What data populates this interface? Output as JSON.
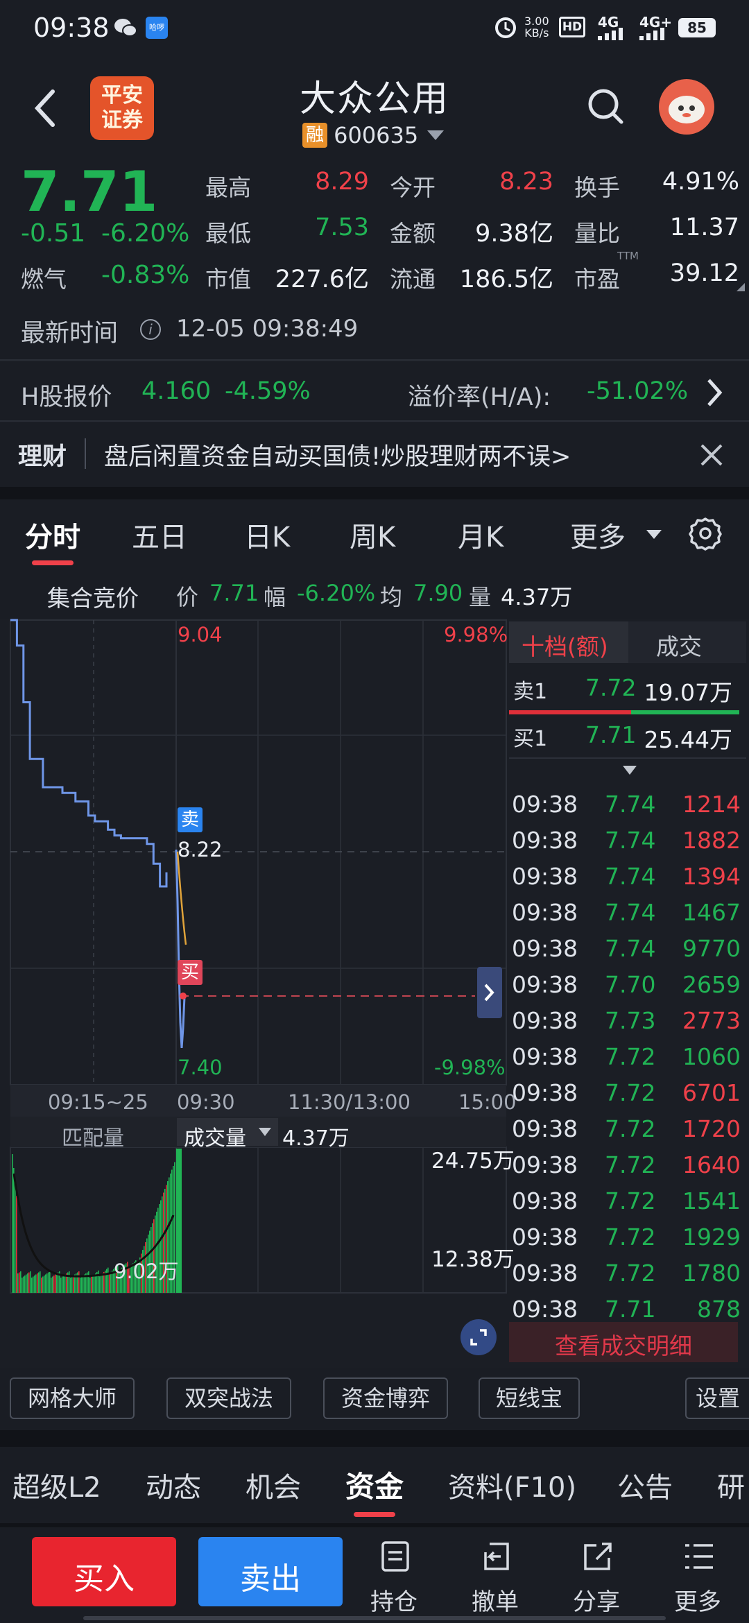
{
  "status_bar": {
    "time": "09:38",
    "net_speed_value": "3.00",
    "net_speed_unit": "KB/s",
    "hd": "HD",
    "net1": "4G",
    "net2": "4G+",
    "battery": "85"
  },
  "header": {
    "broker_logo_line1": "平安",
    "broker_logo_line2": "证券",
    "stock_name": "大众公用",
    "margin_badge": "融",
    "stock_code": "600635"
  },
  "quote": {
    "price": "7.71",
    "change": "-0.51",
    "change_pct": "-6.20%",
    "sector_label": "燃气",
    "sector_change": "-0.83%",
    "high_label": "最高",
    "high": "8.29",
    "low_label": "最低",
    "low": "7.53",
    "mcap_label": "市值",
    "mcap": "227.6亿",
    "open_label": "今开",
    "open": "8.23",
    "amount_label": "金额",
    "amount": "9.38亿",
    "float_label": "流通",
    "float": "186.5亿",
    "turnover_label": "换手",
    "turnover": "4.91%",
    "volratio_label": "量比",
    "volratio": "11.37",
    "pe_label": "市盈",
    "pe_sup": "TTM",
    "pe": "39.12",
    "time_label": "最新时间",
    "time_value": "12-05 09:38:49"
  },
  "h_share": {
    "label": "H股报价",
    "price": "4.160",
    "change": "-4.59%",
    "premium_label": "溢价率(H/A):",
    "premium": "-51.02%"
  },
  "ad": {
    "label": "理财",
    "text": "盘后闲置资金自动买国债!炒股理财两不误>"
  },
  "tabs": {
    "items": [
      "分时",
      "五日",
      "日K",
      "周K",
      "月K",
      "更多"
    ],
    "active": "分时"
  },
  "summary": {
    "title": "集合竞价",
    "price_label": "价",
    "price": "7.71",
    "amp_label": "幅",
    "amp": "-6.20%",
    "avg_label": "均",
    "avg": "7.90",
    "vol_label": "量",
    "vol": "4.37万"
  },
  "chart": {
    "top_price": "9.04",
    "top_pct": "9.98%",
    "mid_price": "8.22",
    "bottom_price": "7.40",
    "bottom_pct": "-9.98%",
    "sell_tag": "卖",
    "buy_tag": "买",
    "x_labels": [
      "09:15~25",
      "09:30",
      "11:30/13:00",
      "15:00"
    ],
    "match_label": "匹配量",
    "vol_select": "成交量",
    "vol_value": "4.37万",
    "vol_max": "24.75万",
    "vol_mid": "12.38万",
    "auction_vol": "9.02万"
  },
  "chart_data": {
    "type": "line",
    "title": "",
    "ylim": [
      7.4,
      9.04
    ],
    "reference_price": 8.22,
    "auction_series": [
      {
        "name": "",
        "values": [
          9.04,
          8.95,
          8.75,
          8.55,
          8.55,
          8.45,
          8.45,
          8.45,
          8.43,
          8.43,
          8.4,
          8.4,
          8.35,
          8.33,
          8.33,
          8.3,
          8.28,
          8.27,
          8.27,
          8.27,
          8.27,
          8.25,
          8.18,
          8.1,
          8.15
        ]
      }
    ],
    "open_series": [
      {
        "name": "",
        "values": [
          8.23,
          8.05,
          7.8,
          7.62,
          7.53,
          7.6,
          7.71
        ]
      }
    ]
  },
  "orderbook": {
    "tab_active": "十档(额)",
    "tab2": "成交",
    "ask_label": "卖1",
    "ask_price": "7.72",
    "ask_amount": "19.07万",
    "bid_label": "买1",
    "bid_price": "7.71",
    "bid_amount": "25.44万",
    "trades": [
      {
        "t": "09:38",
        "p": "7.74",
        "v": "1214",
        "c": "red"
      },
      {
        "t": "09:38",
        "p": "7.74",
        "v": "1882",
        "c": "red"
      },
      {
        "t": "09:38",
        "p": "7.74",
        "v": "1394",
        "c": "red"
      },
      {
        "t": "09:38",
        "p": "7.74",
        "v": "1467",
        "c": "green"
      },
      {
        "t": "09:38",
        "p": "7.74",
        "v": "9770",
        "c": "green"
      },
      {
        "t": "09:38",
        "p": "7.70",
        "v": "2659",
        "c": "green"
      },
      {
        "t": "09:38",
        "p": "7.73",
        "v": "2773",
        "c": "red"
      },
      {
        "t": "09:38",
        "p": "7.72",
        "v": "1060",
        "c": "green"
      },
      {
        "t": "09:38",
        "p": "7.72",
        "v": "6701",
        "c": "red"
      },
      {
        "t": "09:38",
        "p": "7.72",
        "v": "1720",
        "c": "red"
      },
      {
        "t": "09:38",
        "p": "7.72",
        "v": "1640",
        "c": "red"
      },
      {
        "t": "09:38",
        "p": "7.72",
        "v": "1541",
        "c": "green"
      },
      {
        "t": "09:38",
        "p": "7.72",
        "v": "1929",
        "c": "green"
      },
      {
        "t": "09:38",
        "p": "7.72",
        "v": "1780",
        "c": "green"
      },
      {
        "t": "09:38",
        "p": "7.71",
        "v": "878",
        "c": "green"
      }
    ],
    "detail_link": "查看成交明细"
  },
  "tools": {
    "items": [
      "网格大师",
      "双突战法",
      "资金博弈",
      "短线宝",
      "设置"
    ]
  },
  "subtabs": {
    "items": [
      "超级L2",
      "动态",
      "机会",
      "资金",
      "资料(F10)",
      "公告",
      "研"
    ],
    "active": "资金"
  },
  "bottom": {
    "buy": "买入",
    "sell": "卖出",
    "hold": "持仓",
    "cancel": "撤单",
    "share": "分享",
    "more": "更多"
  },
  "colors": {
    "up": "#f0414a",
    "down": "#21b455",
    "price_line": "#6f96e8",
    "avg_line": "#e0a33a",
    "buy_button": "#e8252f",
    "sell_button": "#2a84f0"
  }
}
